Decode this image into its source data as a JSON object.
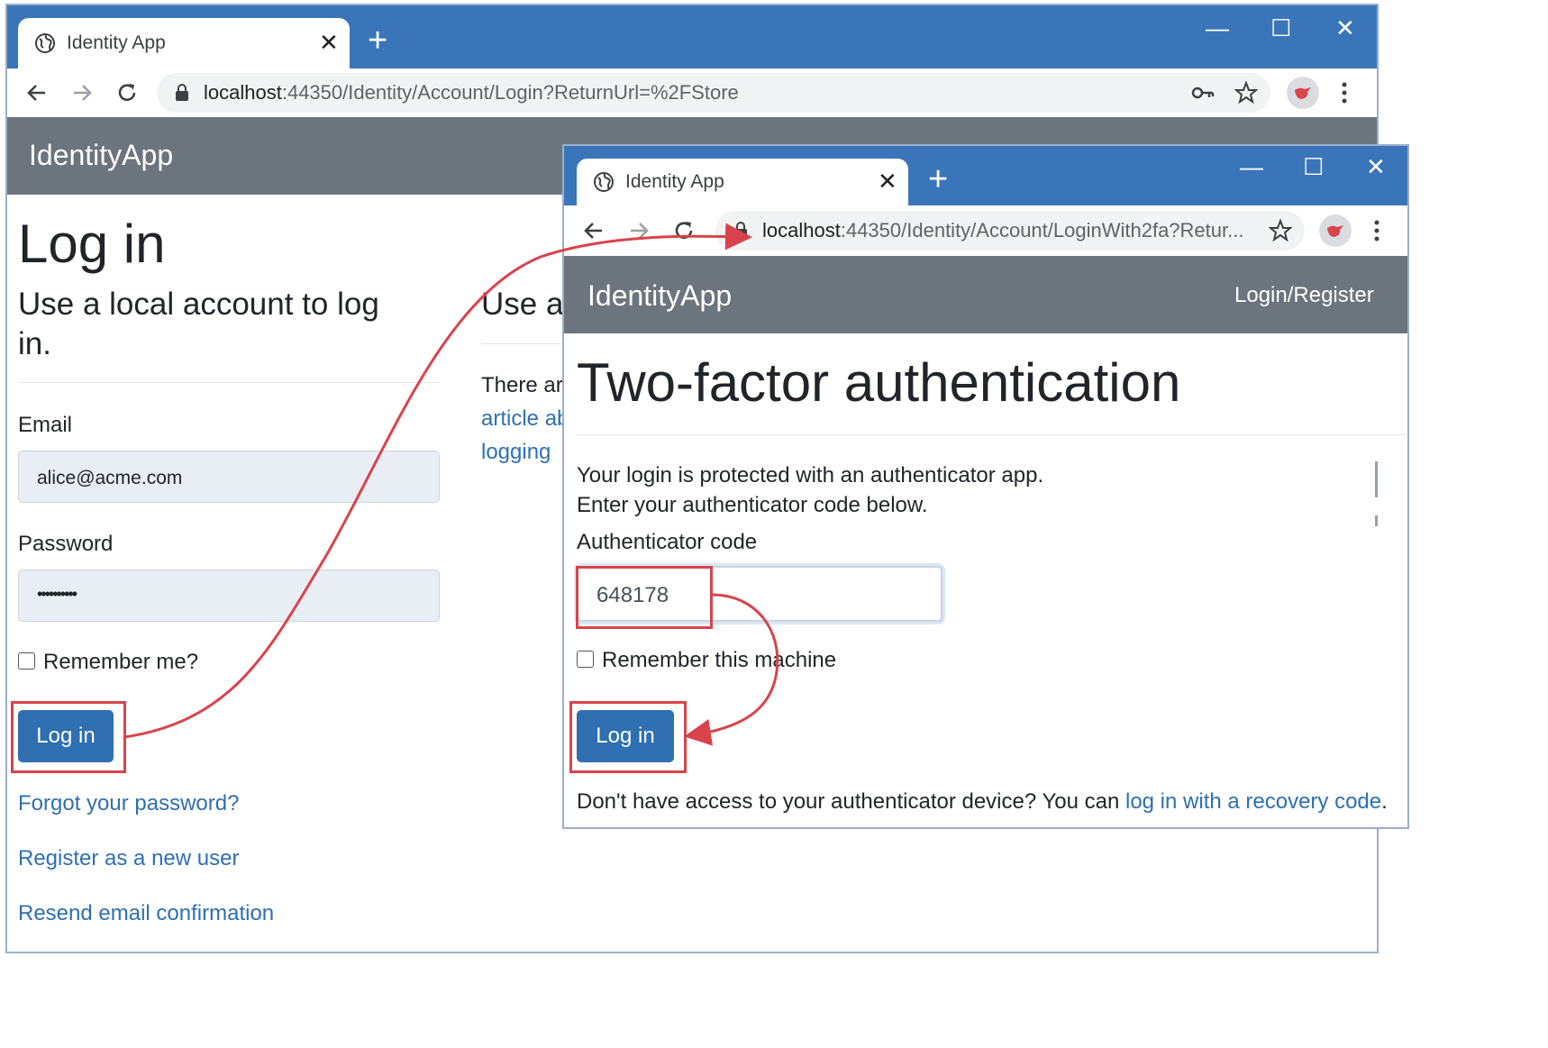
{
  "back_window": {
    "tab_title": "Identity App",
    "url": {
      "host": "localhost",
      "rest": ":44350/Identity/Account/Login?ReturnUrl=%2FStore"
    },
    "brand": "IdentityApp",
    "heading": "Log in",
    "subheading_line1": "Use a local account to log",
    "subheading_line2": "in.",
    "right_heading": "Use a",
    "right_text_line1": "There ar",
    "right_link_line2": "article ab",
    "right_link_line3": "logging",
    "email_label": "Email",
    "email_value": "alice@acme.com",
    "password_label": "Password",
    "password_value": "••••••••••",
    "remember_label": "Remember me?",
    "login_button": "Log in",
    "forgot_link": "Forgot your password?",
    "register_link": "Register as a new user",
    "resend_link": "Resend email confirmation"
  },
  "front_window": {
    "tab_title": "Identity App",
    "url": {
      "host": "localhost",
      "rest": ":44350/Identity/Account/LoginWith2fa?Retur..."
    },
    "brand": "IdentityApp",
    "nav_link": "Login/Register",
    "heading": "Two-factor authentication",
    "info_line1": "Your login is protected with an authenticator app.",
    "info_line2": "Enter your authenticator code below.",
    "code_label": "Authenticator code",
    "code_value": "648178",
    "remember_machine_label": "Remember this machine",
    "login_button": "Log in",
    "recovery_text": "Don't have access to your authenticator device? You can ",
    "recovery_link": "log in with a recovery code",
    "recovery_end": "."
  },
  "colors": {
    "tabstrip": "#3b75b9",
    "navbar": "#6c757d",
    "primary": "#2f6fb2",
    "highlight": "#d9434c"
  }
}
